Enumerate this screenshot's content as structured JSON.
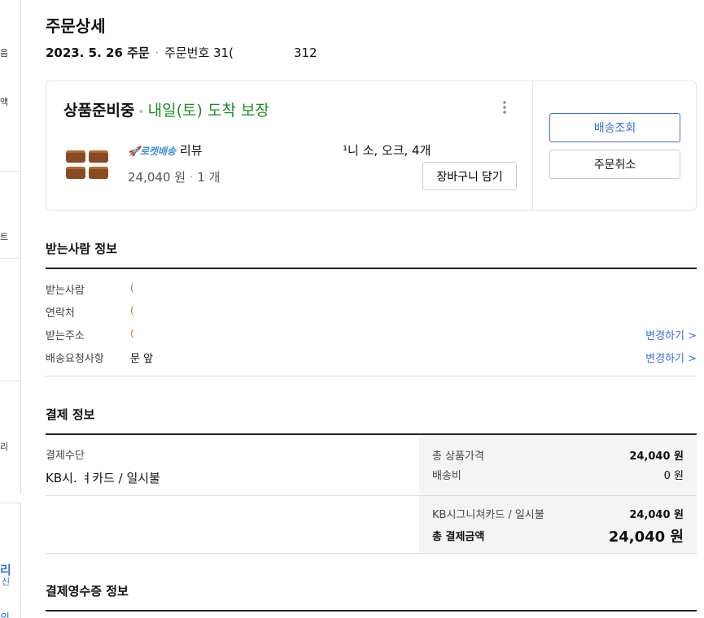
{
  "sidebar": {
    "fragments": [
      "음",
      "액",
      "트",
      "리"
    ],
    "bottom_fragments": [
      "리",
      "신",
      "의"
    ]
  },
  "page": {
    "title": "주문상세",
    "order_date": "2023. 5. 26 주문",
    "order_number_label": "주문번호 31(",
    "order_number_tail": "312"
  },
  "order_card": {
    "status": "상품준비중",
    "arrival": "내일(토) 도착 보장",
    "rocket_label": "로켓배송",
    "product_name_start": "리뷰",
    "product_name_end": "¹니 소, 오크, 4개",
    "price": "24,040 원",
    "quantity": "1 개",
    "cart_button": "장바구니 담기",
    "track_button": "배송조회",
    "cancel_button": "주문취소",
    "more_icon": "kebab-icon"
  },
  "recipient": {
    "title": "받는사람 정보",
    "rows": [
      {
        "label": "받는사람",
        "value": "("
      },
      {
        "label": "연락처",
        "value": "("
      },
      {
        "label": "받는주소",
        "value": "(",
        "link": "변경하기 >"
      },
      {
        "label": "배송요청사항",
        "value": "문 앞",
        "link": "변경하기 >"
      }
    ]
  },
  "payment": {
    "title": "결제 정보",
    "method_label": "결제수단",
    "method_value": "KB시.        ㅕ카드 / 일시불",
    "summary": {
      "product_total_label": "총 상품가격",
      "product_total_value": "24,040 원",
      "shipping_label": "배송비",
      "shipping_value": "0 원",
      "card_label": "KB시그니쳐카드 / 일시불",
      "card_value": "24,040 원",
      "grand_total_label": "총 결제금액",
      "grand_total_value": "24,040 원"
    }
  },
  "receipt": {
    "title": "결제영수증 정보"
  }
}
